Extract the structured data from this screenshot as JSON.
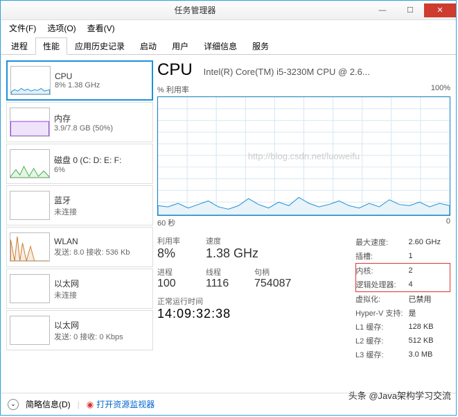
{
  "window": {
    "title": "任务管理器"
  },
  "menu": {
    "file": "文件(F)",
    "options": "选项(O)",
    "view": "查看(V)"
  },
  "tabs": [
    "进程",
    "性能",
    "应用历史记录",
    "启动",
    "用户",
    "详细信息",
    "服务"
  ],
  "active_tab": "性能",
  "sidebar": [
    {
      "title": "CPU",
      "sub": "8% 1.38 GHz",
      "color": "#1e90d6",
      "selected": true
    },
    {
      "title": "内存",
      "sub": "3.9/7.8 GB (50%)",
      "color": "#8a2be2"
    },
    {
      "title": "磁盘 0 (C: D: E: F:",
      "sub": "6%",
      "color": "#3cb043"
    },
    {
      "title": "蓝牙",
      "sub": "未连接",
      "color": "#999"
    },
    {
      "title": "WLAN",
      "sub": "发送: 8.0 接收: 536 Kb",
      "color": "#c97a2b"
    },
    {
      "title": "以太网",
      "sub": "未连接",
      "color": "#999"
    },
    {
      "title": "以太网",
      "sub": "发送: 0 接收: 0 Kbps",
      "color": "#999"
    }
  ],
  "main": {
    "heading": "CPU",
    "subheading": "Intel(R) Core(TM) i5-3230M CPU @ 2.6...",
    "chart_top_left": "% 利用率",
    "chart_top_right": "100%",
    "chart_bottom_left": "60 秒",
    "chart_bottom_right": "0",
    "watermark": "http://blog.csdn.net/luoweifu"
  },
  "stats": {
    "util_label": "利用率",
    "util": "8%",
    "speed_label": "速度",
    "speed": "1.38 GHz",
    "proc_label": "进程",
    "proc": "100",
    "thread_label": "线程",
    "thread": "1116",
    "handle_label": "句柄",
    "handle": "754087",
    "uptime_label": "正常运行时间",
    "uptime": "14:09:32:38"
  },
  "details": {
    "max_speed_l": "最大速度:",
    "max_speed": "2.60 GHz",
    "sockets_l": "插槽:",
    "sockets": "1",
    "cores_l": "内核:",
    "cores": "2",
    "logical_l": "逻辑处理器:",
    "logical": "4",
    "virt_l": "虚拟化:",
    "virt": "已禁用",
    "hyperv_l": "Hyper-V 支持:",
    "hyperv": "是",
    "l1_l": "L1 缓存:",
    "l1": "128 KB",
    "l2_l": "L2 缓存:",
    "l2": "512 KB",
    "l3_l": "L3 缓存:",
    "l3": "3.0 MB"
  },
  "footer": {
    "brief": "简略信息(D)",
    "resmon": "打开资源监视器"
  },
  "caption": "头条 @Java架构学习交流",
  "chart_data": {
    "type": "line",
    "title": "% 利用率",
    "ylim": [
      0,
      100
    ],
    "xlabel": "60 秒",
    "x_range_seconds": [
      60,
      0
    ],
    "series": [
      {
        "name": "CPU",
        "values": [
          8,
          7,
          10,
          6,
          9,
          12,
          7,
          5,
          8,
          14,
          9,
          6,
          11,
          8,
          15,
          10,
          7,
          9,
          12,
          8,
          6,
          10,
          7,
          13,
          9,
          8,
          11,
          7,
          10,
          8
        ]
      }
    ]
  }
}
